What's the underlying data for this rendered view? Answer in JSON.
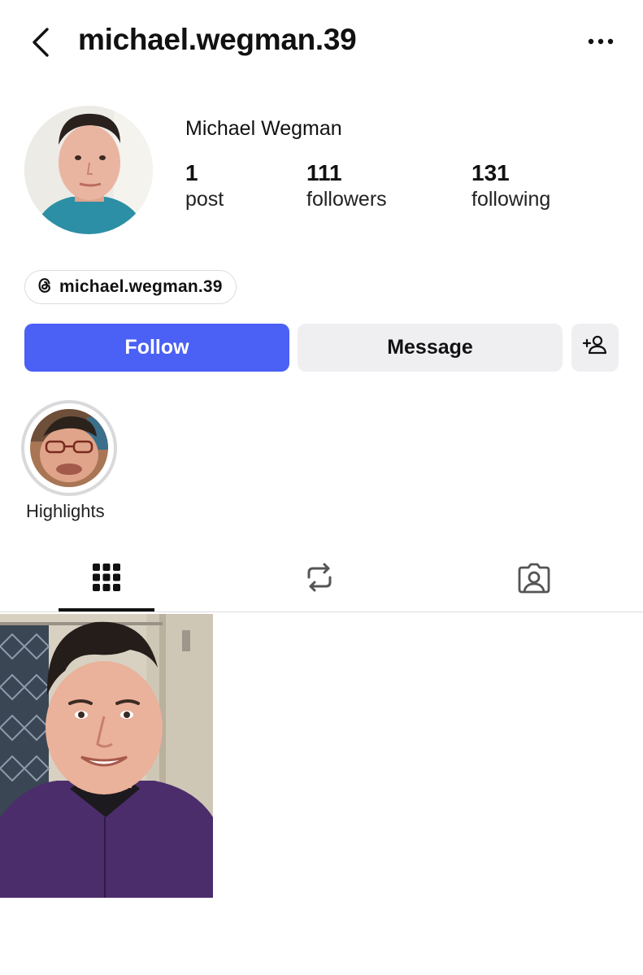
{
  "header": {
    "username": "michael.wegman.39",
    "back_icon": "chevron-left-icon",
    "more_icon": "more-horizontal-icon"
  },
  "profile": {
    "display_name": "Michael Wegman",
    "stats": [
      {
        "value": "1",
        "label": "post"
      },
      {
        "value": "111",
        "label": "followers"
      },
      {
        "value": "131",
        "label": "following"
      }
    ],
    "threads_handle": "michael.wegman.39",
    "threads_icon": "threads-icon"
  },
  "actions": {
    "follow_label": "Follow",
    "message_label": "Message",
    "add_user_icon": "add-user-icon"
  },
  "highlights": [
    {
      "label": "Highlights"
    }
  ],
  "tabs": [
    {
      "name": "posts",
      "icon": "grid-icon",
      "active": true
    },
    {
      "name": "reposts",
      "icon": "repost-icon",
      "active": false
    },
    {
      "name": "tagged",
      "icon": "tagged-user-icon",
      "active": false
    }
  ],
  "posts": [
    {
      "type": "photo"
    }
  ],
  "colors": {
    "follow_button": "#4b60f5",
    "secondary_button": "#efeff2",
    "text": "#111111"
  }
}
